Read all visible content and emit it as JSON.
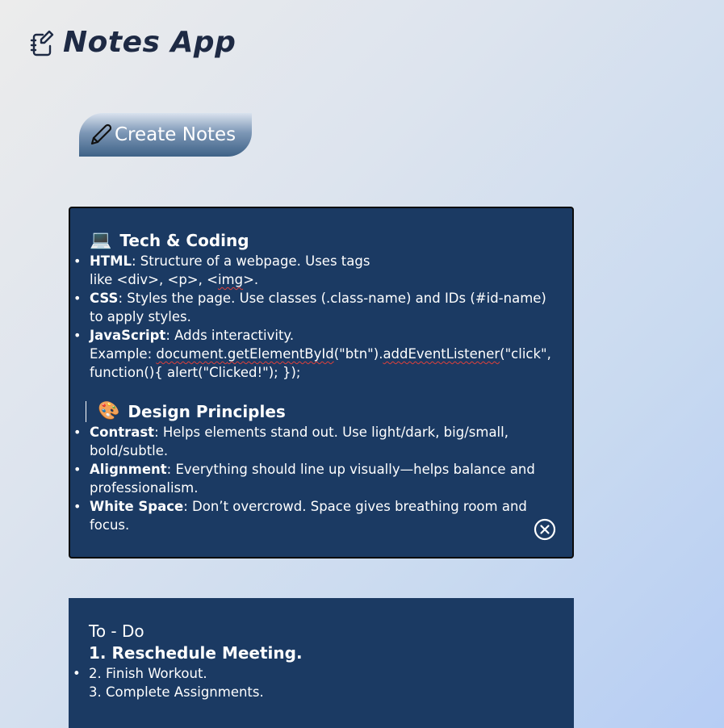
{
  "app": {
    "title": "Notes App",
    "icon": "notebook-edit-icon"
  },
  "toolbar": {
    "create_label": "Create Notes",
    "create_icon": "pencil-icon"
  },
  "colors": {
    "note_background": "#1b3a63",
    "title_color": "#1e2a44",
    "button_gradient_top": "#d9e2ee",
    "button_gradient_bottom": "#3e6287"
  },
  "notes": [
    {
      "sections": [
        {
          "emoji": "💻",
          "heading": "Tech & Coding",
          "items": [
            {
              "term": "HTML",
              "text_a": ": Structure of a webpage. Uses tags",
              "text_b": "like <div>, <p>, <",
              "squiggle": "img",
              "text_c": ">."
            },
            {
              "term": "CSS",
              "text": ": Styles the page. Use classes (.class-name) and IDs (#id-name) to apply styles."
            },
            {
              "term": "JavaScript",
              "text_a": ": Adds interactivity.",
              "example_label": "Example: ",
              "code_a": "document.",
              "code_sq1": "getElementById",
              "code_b": "(\"btn\").",
              "code_sq2": "addEventListener",
              "code_c": "(\"click\", function(){ alert(\"Clicked!\"); });"
            }
          ]
        },
        {
          "emoji": "🎨",
          "heading": "Design Principles",
          "items": [
            {
              "term": "Contrast",
              "text": ": Helps elements stand out. Use light/dark, big/small, bold/subtle."
            },
            {
              "term": "Alignment",
              "text": ": Everything should line up visually—helps balance and professionalism."
            },
            {
              "term": "White Space",
              "text": ": Don’t overcrowd. Space gives breathing room and focus."
            }
          ]
        }
      ],
      "close_icon": "close-circle-icon"
    },
    {
      "title": "To - Do",
      "line1": "1. Reschedule Meeting.",
      "line2": "2. Finish Workout.",
      "line3": "3. Complete Assignments."
    }
  ]
}
